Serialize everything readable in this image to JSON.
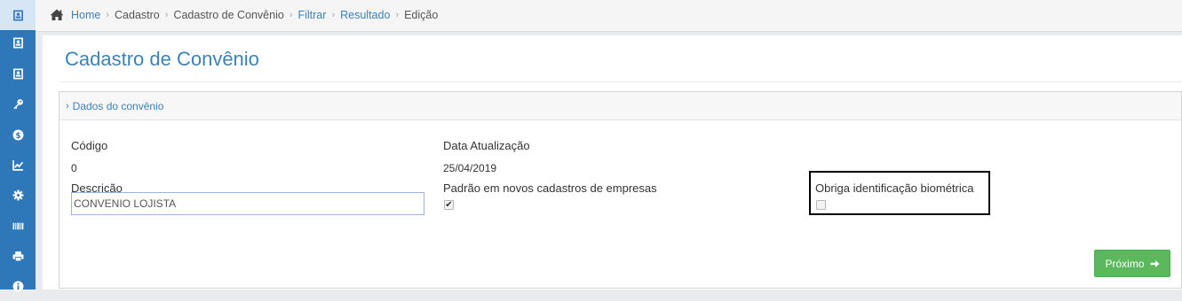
{
  "sidebar": {
    "items": [
      {
        "icon": "contact-card-icon",
        "active": true
      },
      {
        "icon": "contact-card-icon"
      },
      {
        "icon": "contact-card-icon"
      },
      {
        "icon": "key-icon"
      },
      {
        "icon": "dollar-icon"
      },
      {
        "icon": "line-chart-icon"
      },
      {
        "icon": "gear-icon"
      },
      {
        "icon": "barcode-icon"
      },
      {
        "icon": "printer-icon"
      },
      {
        "icon": "info-icon"
      }
    ]
  },
  "breadcrumb": {
    "home": "Home",
    "cadastro": "Cadastro",
    "cadastro_convenio": "Cadastro de Convênio",
    "filtrar": "Filtrar",
    "resultado": "Resultado",
    "edicao": "Edição"
  },
  "page": {
    "title": "Cadastro de Convênio"
  },
  "panel": {
    "title": "Dados do convênio"
  },
  "form": {
    "codigo_label": "Código",
    "codigo_value": "0",
    "data_label": "Data Atualização",
    "data_value": "25/04/2019",
    "descricao_label": "Descrição",
    "descricao_value": "CONVENIO LOJISTA",
    "padrao_label": "Padrão em novos cadastros de empresas",
    "padrao_checked": true,
    "biometria_label": "Obriga identificação biométrica",
    "biometria_checked": false
  },
  "actions": {
    "next_label": "Próximo"
  },
  "colors": {
    "sidebar": "#2e77b8",
    "accent": "#3d82b5",
    "success": "#5cb85c"
  }
}
